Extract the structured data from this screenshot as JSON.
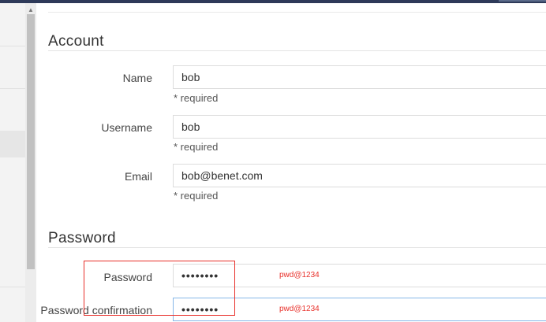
{
  "account": {
    "title": "Account",
    "name": {
      "label": "Name",
      "value": "bob",
      "hint": "* required"
    },
    "username": {
      "label": "Username",
      "value": "bob",
      "hint": "* required"
    },
    "email": {
      "label": "Email",
      "value": "bob@benet.com",
      "hint": "* required"
    }
  },
  "password": {
    "title": "Password",
    "password": {
      "label": "Password",
      "masked": "••••••••",
      "note": "pwd@1234"
    },
    "confirmation": {
      "label": "Password confirmation",
      "masked": "••••••••",
      "note": "pwd@1234"
    }
  },
  "scrollbar": {
    "up_glyph": "▲"
  },
  "colors": {
    "annotation": "#e8302a",
    "focus_border": "#86b7e8",
    "topbar": "#2e3a59"
  }
}
